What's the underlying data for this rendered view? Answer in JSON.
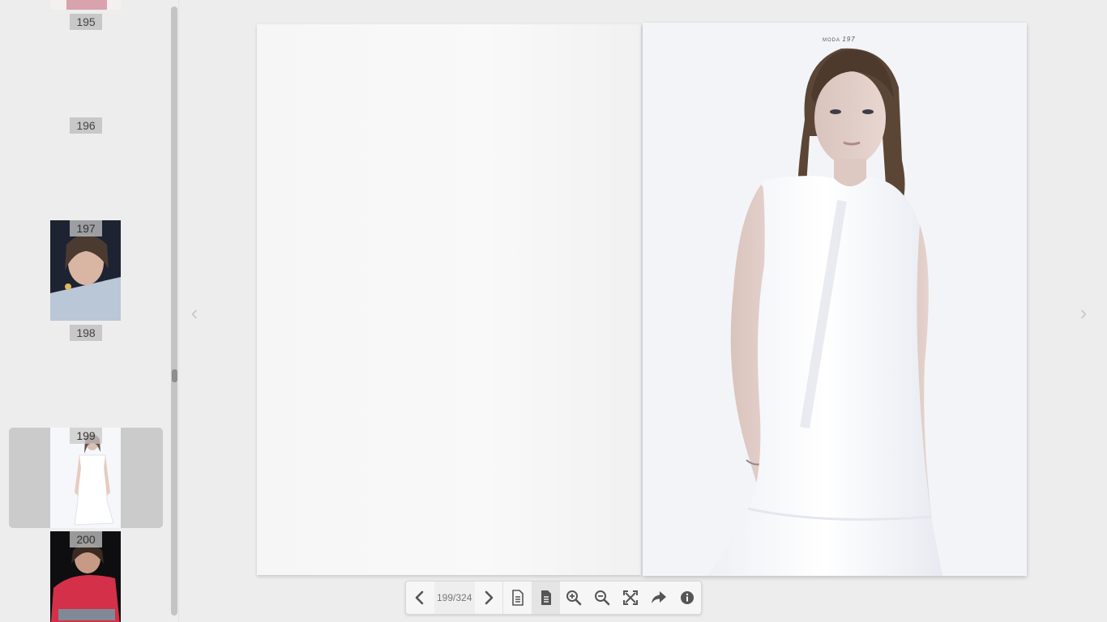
{
  "sidebar": {
    "thumbnails": [
      {
        "page": "195"
      },
      {
        "page": "196"
      },
      {
        "page": "197"
      },
      {
        "page": "198"
      },
      {
        "page": "199",
        "selected": true
      },
      {
        "page": "200"
      }
    ]
  },
  "right_page": {
    "folio_section": "MODA",
    "folio_number": "197"
  },
  "toolbar": {
    "page_counter": "199/324",
    "buttons": [
      "previous-page",
      "next-page",
      "single-page-view",
      "double-page-view",
      "zoom-in",
      "zoom-out",
      "fullscreen",
      "share",
      "info"
    ]
  },
  "colors": {
    "selected_thumb_bg": "#cbcbcb",
    "sidebar_bg": "#ededed",
    "toolbar_icon": "#555555"
  }
}
